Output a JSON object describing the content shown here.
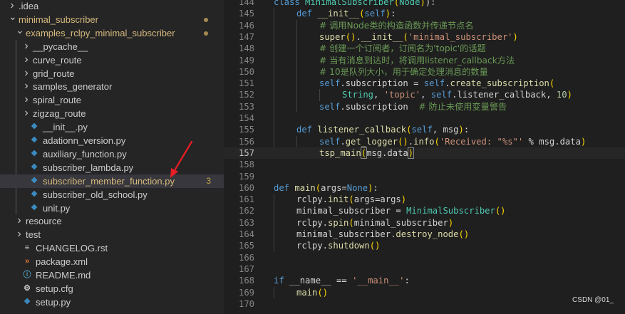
{
  "explorer": {
    "items": [
      {
        "label": ".idea",
        "chevron": ">",
        "icon": "folder",
        "indent": 0
      },
      {
        "label": "minimal_subscriber",
        "chevron": "v",
        "icon": "folder",
        "indent": 0,
        "status_dot": true
      },
      {
        "label": "examples_rclpy_minimal_subscriber",
        "chevron": "v",
        "icon": "folder",
        "indent": 1,
        "status_dot": true
      },
      {
        "label": "__pycache__",
        "chevron": ">",
        "icon": "folder",
        "indent": 2
      },
      {
        "label": "curve_route",
        "chevron": ">",
        "icon": "folder",
        "indent": 2
      },
      {
        "label": "grid_route",
        "chevron": ">",
        "icon": "folder",
        "indent": 2
      },
      {
        "label": "samples_generator",
        "chevron": ">",
        "icon": "folder",
        "indent": 2
      },
      {
        "label": "spiral_route",
        "chevron": ">",
        "icon": "folder",
        "indent": 2
      },
      {
        "label": "zigzag_route",
        "chevron": ">",
        "icon": "folder",
        "indent": 2
      },
      {
        "label": "__init__.py",
        "icon": "python",
        "indent": 2
      },
      {
        "label": "adationn_version.py",
        "icon": "python",
        "indent": 2
      },
      {
        "label": "auxiliary_function.py",
        "icon": "python",
        "indent": 2
      },
      {
        "label": "subscriber_lambda.py",
        "icon": "python",
        "indent": 2
      },
      {
        "label": "subscriber_member_function.py",
        "icon": "python",
        "indent": 2,
        "selected": true,
        "modified": true,
        "badge": "3"
      },
      {
        "label": "subscriber_old_school.py",
        "icon": "python",
        "indent": 2
      },
      {
        "label": "unit.py",
        "icon": "python",
        "indent": 2
      },
      {
        "label": "resource",
        "chevron": ">",
        "icon": "folder",
        "indent": 1
      },
      {
        "label": "test",
        "chevron": ">",
        "icon": "folder",
        "indent": 1
      },
      {
        "label": "CHANGELOG.rst",
        "icon": "rst",
        "indent": 1
      },
      {
        "label": "package.xml",
        "icon": "rss",
        "indent": 1
      },
      {
        "label": "README.md",
        "icon": "info",
        "indent": 1
      },
      {
        "label": "setup.cfg",
        "icon": "gear",
        "indent": 1
      },
      {
        "label": "setup.py",
        "icon": "python",
        "indent": 1
      }
    ],
    "colors": {
      "modified": "#d7ba7d",
      "selected_bg": "#37373d",
      "python_icon": "#3c8dc4",
      "rss_icon": "#e37933"
    }
  },
  "editor": {
    "current_line": 157,
    "lines": [
      {
        "n": 144,
        "indent": 0,
        "tokens": [
          [
            "kw",
            "class "
          ],
          [
            "cl",
            "MinimalSubscriber"
          ],
          [
            "p1",
            "("
          ],
          [
            "cl",
            "Node"
          ],
          [
            "p1",
            ")"
          ],
          [
            "",
            "):"
          ]
        ]
      },
      {
        "n": 145,
        "indent": 1,
        "tokens": [
          [
            "kw",
            "def "
          ],
          [
            "fn",
            "__init__"
          ],
          [
            "p1",
            "("
          ],
          [
            "sf",
            "self"
          ],
          [
            "p1",
            ")"
          ],
          [
            "",
            ":"
          ]
        ]
      },
      {
        "n": 146,
        "indent": 2,
        "tokens": [
          [
            "cm",
            "# 调用Node类的构造函数并传递节点名"
          ]
        ]
      },
      {
        "n": 147,
        "indent": 2,
        "tokens": [
          [
            "fn",
            "super"
          ],
          [
            "p1",
            "()"
          ],
          [
            "",
            "."
          ],
          [
            "fn",
            "__init__"
          ],
          [
            "p1",
            "("
          ],
          [
            "st",
            "'minimal_subscriber'"
          ],
          [
            "p1",
            ")"
          ]
        ]
      },
      {
        "n": 148,
        "indent": 2,
        "tokens": [
          [
            "cm",
            "# 创建一个订阅者，订阅名为'topic'的话题"
          ]
        ]
      },
      {
        "n": 149,
        "indent": 2,
        "tokens": [
          [
            "cm",
            "# 当有消息到达时，将调用listener_callback方法"
          ]
        ]
      },
      {
        "n": 150,
        "indent": 2,
        "tokens": [
          [
            "cm",
            "# 10是队列大小，用于确定处理消息的数量"
          ]
        ]
      },
      {
        "n": 151,
        "indent": 2,
        "tokens": [
          [
            "sf",
            "self"
          ],
          [
            "",
            ".subscription = "
          ],
          [
            "sf",
            "self"
          ],
          [
            "",
            "."
          ],
          [
            "fn",
            "create_subscription"
          ],
          [
            "p1",
            "("
          ]
        ]
      },
      {
        "n": 152,
        "indent": 3,
        "tokens": [
          [
            "cl",
            "String"
          ],
          [
            "",
            ", "
          ],
          [
            "st",
            "'topic'"
          ],
          [
            "",
            ", "
          ],
          [
            "sf",
            "self"
          ],
          [
            "",
            ".listener_callback, "
          ],
          [
            "nu",
            "10"
          ],
          [
            "p1",
            ")"
          ]
        ]
      },
      {
        "n": 153,
        "indent": 2,
        "tokens": [
          [
            "sf",
            "self"
          ],
          [
            "",
            ".subscription  "
          ],
          [
            "cm",
            "# 防止未使用变量警告"
          ]
        ]
      },
      {
        "n": 154,
        "indent": 0,
        "tokens": []
      },
      {
        "n": 155,
        "indent": 1,
        "tokens": [
          [
            "kw",
            "def "
          ],
          [
            "fn",
            "listener_callback"
          ],
          [
            "p1",
            "("
          ],
          [
            "sf",
            "self"
          ],
          [
            "",
            ", msg"
          ],
          [
            "p1",
            ")"
          ],
          [
            "",
            ":"
          ]
        ]
      },
      {
        "n": 156,
        "indent": 2,
        "tokens": [
          [
            "sf",
            "self"
          ],
          [
            "",
            "."
          ],
          [
            "fn",
            "get_logger"
          ],
          [
            "p1",
            "()"
          ],
          [
            "",
            "."
          ],
          [
            "fn",
            "info"
          ],
          [
            "p1",
            "("
          ],
          [
            "st",
            "'Received: \"%s\"'"
          ],
          [
            "",
            " % msg.data"
          ],
          [
            "p1",
            ")"
          ]
        ]
      },
      {
        "n": 157,
        "indent": 2,
        "tokens": [
          [
            "fn",
            "tsp_main"
          ],
          [
            "p1bracket",
            "("
          ],
          [
            "",
            "msg.data"
          ],
          [
            "p1bracket",
            ")"
          ],
          [
            "cursor",
            ""
          ]
        ]
      },
      {
        "n": 158,
        "indent": 0,
        "tokens": []
      },
      {
        "n": 159,
        "indent": 0,
        "tokens": []
      },
      {
        "n": 160,
        "indent": 0,
        "tokens": [
          [
            "kw",
            "def "
          ],
          [
            "fn",
            "main"
          ],
          [
            "p1",
            "("
          ],
          [
            "",
            "args="
          ],
          [
            "kw",
            "None"
          ],
          [
            "p1",
            ")"
          ],
          [
            "",
            ":"
          ]
        ]
      },
      {
        "n": 161,
        "indent": 1,
        "tokens": [
          [
            "",
            "rclpy."
          ],
          [
            "fn",
            "init"
          ],
          [
            "p1",
            "("
          ],
          [
            "",
            "args=args"
          ],
          [
            "p1",
            ")"
          ]
        ]
      },
      {
        "n": 162,
        "indent": 1,
        "tokens": [
          [
            "",
            "minimal_subscriber = "
          ],
          [
            "cl",
            "MinimalSubscriber"
          ],
          [
            "p1",
            "()"
          ]
        ]
      },
      {
        "n": 163,
        "indent": 1,
        "tokens": [
          [
            "",
            "rclpy."
          ],
          [
            "fn",
            "spin"
          ],
          [
            "p1",
            "("
          ],
          [
            "",
            "minimal_subscriber"
          ],
          [
            "p1",
            ")"
          ]
        ]
      },
      {
        "n": 164,
        "indent": 1,
        "tokens": [
          [
            "",
            "minimal_subscriber."
          ],
          [
            "fn",
            "destroy_node"
          ],
          [
            "p1",
            "()"
          ]
        ]
      },
      {
        "n": 165,
        "indent": 1,
        "tokens": [
          [
            "",
            "rclpy."
          ],
          [
            "fn",
            "shutdown"
          ],
          [
            "p1",
            "()"
          ]
        ]
      },
      {
        "n": 166,
        "indent": 0,
        "tokens": []
      },
      {
        "n": 167,
        "indent": 0,
        "tokens": []
      },
      {
        "n": 168,
        "indent": 0,
        "tokens": [
          [
            "kw",
            "if "
          ],
          [
            "",
            "__name__ == "
          ],
          [
            "st",
            "'__main__'"
          ],
          [
            "",
            ":"
          ]
        ]
      },
      {
        "n": 169,
        "indent": 1,
        "tokens": [
          [
            "fn",
            "main"
          ],
          [
            "p1",
            "()"
          ]
        ]
      },
      {
        "n": 170,
        "indent": 0,
        "tokens": []
      }
    ]
  },
  "watermark": "CSDN @01_"
}
